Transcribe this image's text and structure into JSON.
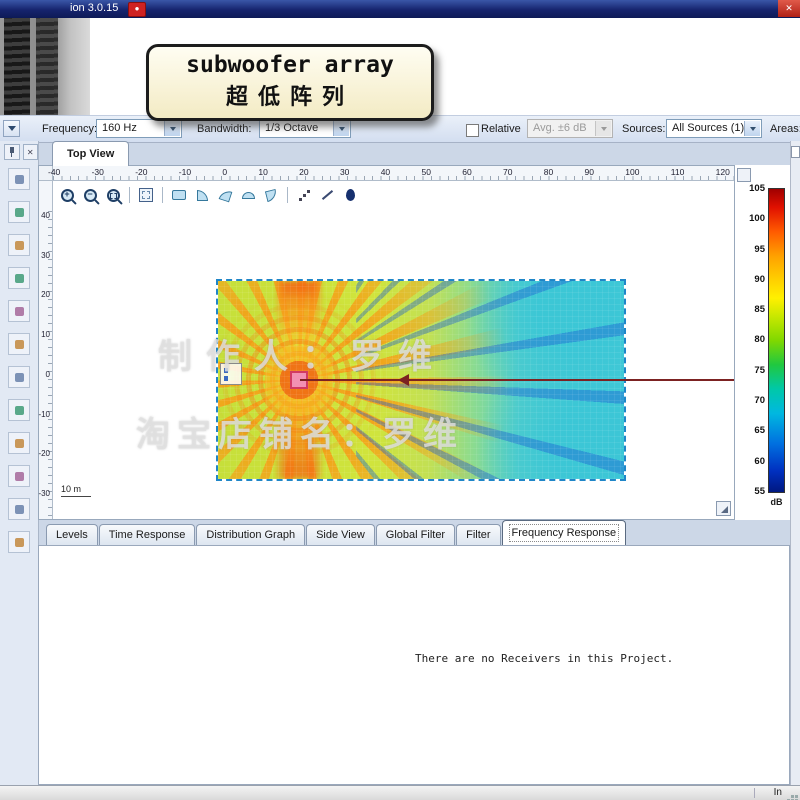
{
  "titlebar": {
    "title": "ion 3.0.15"
  },
  "icons": {
    "close": "✕"
  },
  "overlay_callout": {
    "line1": "subwoofer array",
    "line2": "超低阵列"
  },
  "toolbar": {
    "frequency_label": "Frequency:",
    "frequency_value": "160 Hz",
    "bandwidth_label": "Bandwidth:",
    "bandwidth_value": "1/3 Octave",
    "relative_label": "Relative",
    "avg_value": "Avg. ±6 dB",
    "sources_label": "Sources:",
    "sources_value": "All Sources (1)",
    "areas_label": "Areas:"
  },
  "view": {
    "tab_label": "Top View",
    "scale_label": "10 m",
    "watermark_line1": "制作人：罗维",
    "watermark_line2": "淘宝店铺名：罗维",
    "top_ruler_ticks": [
      "-40",
      "-30",
      "-20",
      "-10",
      "0",
      "10",
      "20",
      "30",
      "40",
      "50",
      "60",
      "70",
      "80",
      "90",
      "100",
      "110",
      "120"
    ],
    "left_ruler_ticks": [
      "40",
      "30",
      "20",
      "10",
      "0",
      "-10",
      "-20",
      "-30"
    ]
  },
  "colorbar": {
    "ticks": [
      "105",
      "100",
      "95",
      "90",
      "85",
      "80",
      "75",
      "70",
      "65",
      "60",
      "55"
    ],
    "unit": "dB"
  },
  "bottom_tabs": [
    {
      "label": "Levels"
    },
    {
      "label": "Time Response"
    },
    {
      "label": "Distribution Graph"
    },
    {
      "label": "Side View"
    },
    {
      "label": "Global Filter"
    },
    {
      "label": "Filter"
    },
    {
      "label": "Frequency Response",
      "active": true
    }
  ],
  "bottom_panel": {
    "message": "There are no Receivers in this Project."
  },
  "statusbar": {
    "right_label": "In"
  }
}
